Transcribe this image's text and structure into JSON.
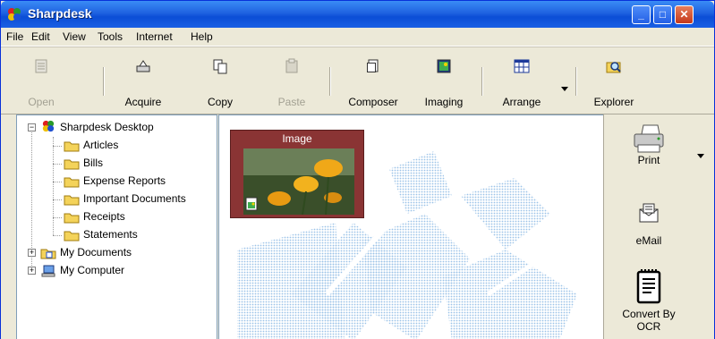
{
  "window": {
    "title": "Sharpdesk",
    "controls": {
      "minimize": "_",
      "maximize": "□",
      "close": "✕"
    }
  },
  "menu": [
    "File",
    "Edit",
    "View",
    "Tools",
    "Internet",
    "Help"
  ],
  "toolbar": {
    "open": "Open",
    "acquire": "Acquire",
    "copy": "Copy",
    "paste": "Paste",
    "composer": "Composer",
    "imaging": "Imaging",
    "arrange": "Arrange",
    "explorer": "Explorer"
  },
  "tree": {
    "root": "Sharpdesk Desktop",
    "folders": [
      "Articles",
      "Bills",
      "Expense Reports",
      "Important Documents",
      "Receipts",
      "Statements"
    ],
    "my_documents": "My Documents",
    "my_computer": "My Computer"
  },
  "content": {
    "thumbnail_title": "Image"
  },
  "side_tools": {
    "print": "Print",
    "email": "eMail",
    "ocr": "Convert By OCR"
  },
  "colors": {
    "titlebar": "#0b4ed6",
    "thumbnail_frame": "#8a3434",
    "tree_border": "#7f9db9"
  }
}
